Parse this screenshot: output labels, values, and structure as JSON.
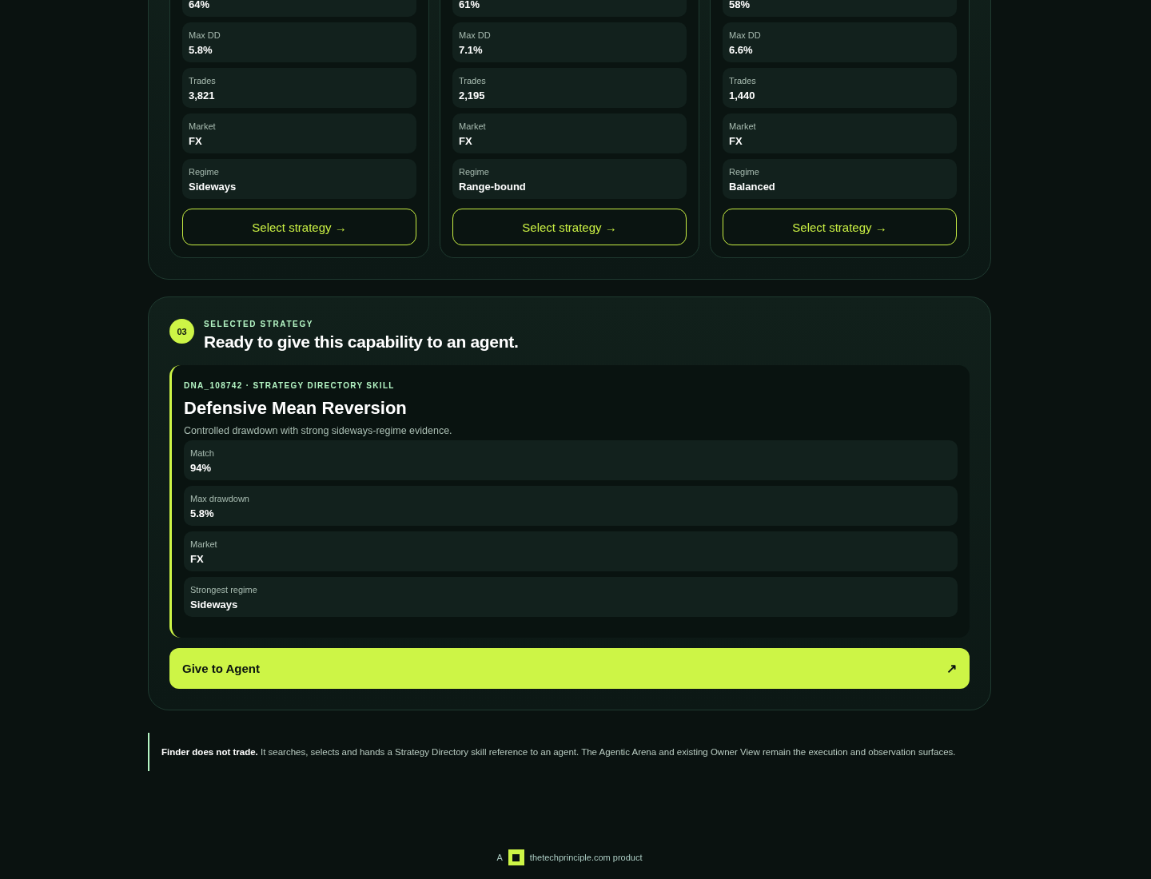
{
  "strategies": [
    {
      "metrics": [
        {
          "value": "64%"
        },
        {
          "label": "Max DD",
          "value": "5.8%"
        },
        {
          "label": "Trades",
          "value": "3,821"
        },
        {
          "label": "Market",
          "value": "FX"
        },
        {
          "label": "Regime",
          "value": "Sideways"
        }
      ],
      "button": "Select strategy →"
    },
    {
      "metrics": [
        {
          "value": "61%"
        },
        {
          "label": "Max DD",
          "value": "7.1%"
        },
        {
          "label": "Trades",
          "value": "2,195"
        },
        {
          "label": "Market",
          "value": "FX"
        },
        {
          "label": "Regime",
          "value": "Range-bound"
        }
      ],
      "button": "Select strategy →"
    },
    {
      "metrics": [
        {
          "value": "58%"
        },
        {
          "label": "Max DD",
          "value": "6.6%"
        },
        {
          "label": "Trades",
          "value": "1,440"
        },
        {
          "label": "Market",
          "value": "FX"
        },
        {
          "label": "Regime",
          "value": "Balanced"
        }
      ],
      "button": "Select strategy →"
    }
  ],
  "selected": {
    "step": "03",
    "eyebrow": "SELECTED STRATEGY",
    "heading": "Ready to give this capability to an agent.",
    "card": {
      "eyebrow": "DNA_108742 · STRATEGY DIRECTORY SKILL",
      "title": "Defensive Mean Reversion",
      "description": "Controlled drawdown with strong sideways-regime evidence.",
      "metrics": [
        {
          "label": "Match",
          "value": "94%"
        },
        {
          "label": "Max drawdown",
          "value": "5.8%"
        },
        {
          "label": "Market",
          "value": "FX"
        },
        {
          "label": "Strongest regime",
          "value": "Sideways"
        }
      ]
    },
    "button": {
      "label": "Give to Agent",
      "icon": "↗"
    }
  },
  "note": "**Finder does not trade.** It searches, selects and hands a Strategy Directory skill reference to an agent. The Agentic Arena and existing Owner View remain the execution and observation surfaces.",
  "footer": {
    "prefix": "A",
    "text": "thetechprinciple.com product"
  }
}
